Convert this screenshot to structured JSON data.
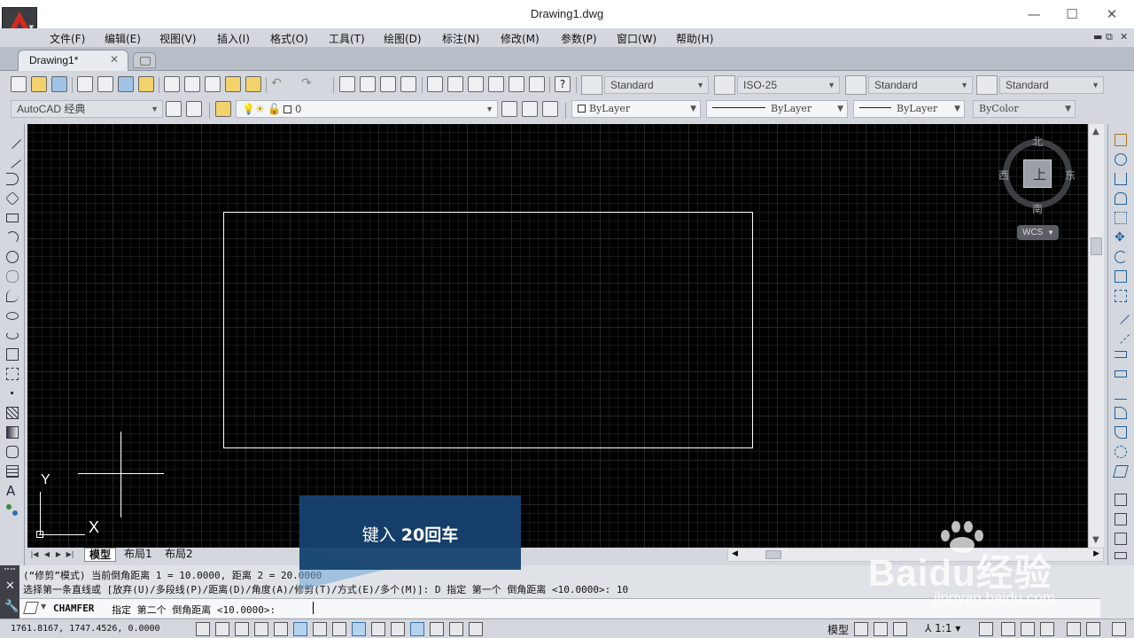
{
  "window": {
    "title": "Drawing1.dwg",
    "minimize": "—",
    "maximize": "☐",
    "close": "✕"
  },
  "menu": {
    "items": [
      "文件(F)",
      "编辑(E)",
      "视图(V)",
      "插入(I)",
      "格式(O)",
      "工具(T)",
      "绘图(D)",
      "标注(N)",
      "修改(M)",
      "参数(P)",
      "窗口(W)",
      "帮助(H)"
    ]
  },
  "tabs": {
    "active": "Drawing1*",
    "close": "✕"
  },
  "styles": {
    "text_style": "Standard",
    "dim_style": "ISO-25",
    "table_style": "Standard",
    "mleader_style": "Standard"
  },
  "workspace": {
    "name": "AutoCAD 经典",
    "layer": "0",
    "color": "ByLayer",
    "linetype": "ByLayer",
    "lineweight": "ByLayer",
    "plotstyle": "ByColor"
  },
  "viewcube": {
    "north": "北",
    "south": "南",
    "east": "东",
    "west": "西",
    "face": "上",
    "wcs": "WCS"
  },
  "ucs": {
    "x": "X",
    "y": "Y"
  },
  "layout_tabs": {
    "model": "模型",
    "layout1": "布局1",
    "layout2": "布局2"
  },
  "command": {
    "history_1": "(“修剪”模式) 当前倒角距离 1 = 10.0000, 距离 2 = 20.0000",
    "history_2": "选择第一条直线或 [放弃(U)/多段线(P)/距离(D)/角度(A)/修剪(T)/方式(E)/多个(M)]: D 指定 第一个 倒角距离 <10.0000>: 10",
    "name": "CHAMFER",
    "prompt": "指定 第二个 倒角距离 <10.0000>:"
  },
  "status": {
    "coordinates": "1761.8167, 1747.4526, 0.0000",
    "model": "模型",
    "scale": "1:1"
  },
  "overlay": {
    "hint_prefix": "键入 ",
    "hint_bold": "20回车"
  },
  "watermark": {
    "brand": "Baidu经验",
    "url": "jingyan.baidu.com"
  },
  "colors": {
    "canvas_bg": "#000000",
    "chrome": "#d4d8de",
    "accent": "#d42a1e",
    "hint_bg": "#164270"
  }
}
